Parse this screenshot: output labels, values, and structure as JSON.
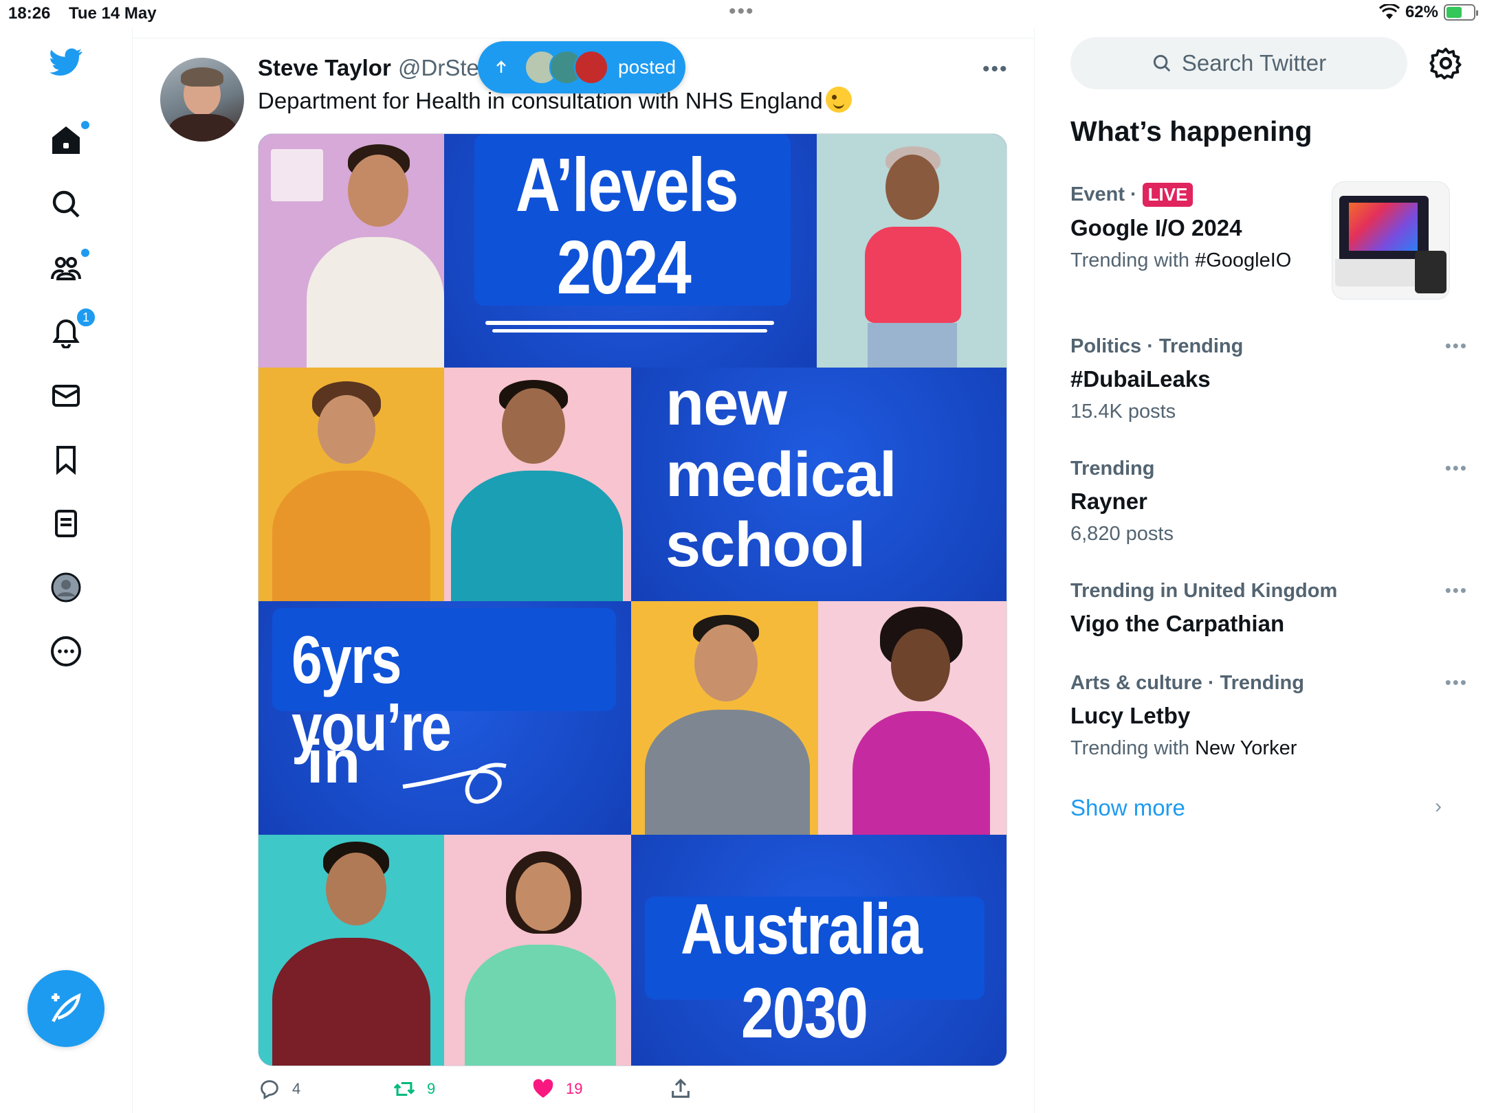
{
  "status_bar": {
    "time": "18:26",
    "date": "Tue 14 May",
    "battery": "62%",
    "battery_level": 0.62
  },
  "nav": {
    "notifications_badge": "1"
  },
  "tweet": {
    "author_name": "Steve Taylor",
    "author_handle": "@DrSte",
    "text": "Department for Health in consultation with NHS England",
    "posted_pill": "posted",
    "media": {
      "headline_1a": "A’levels",
      "headline_1b": "2024",
      "headline_2a": "new",
      "headline_2b": "medical",
      "headline_2c": "school",
      "headline_3a": "6yrs you’re",
      "headline_3b": "in",
      "headline_4a": "Australia",
      "headline_4b": "2030"
    },
    "replies": "4",
    "retweets": "9",
    "likes": "19"
  },
  "sidebar": {
    "search_placeholder": "Search Twitter",
    "whats_happening": "What’s happening",
    "trends": [
      {
        "meta": "Event",
        "badge": "LIVE",
        "title": "Google I/O 2024",
        "sub_prefix": "Trending with",
        "sub_value": "#GoogleIO"
      },
      {
        "meta": "Politics · Trending",
        "title": "#DubaiLeaks",
        "sub_prefix": "15.4K posts"
      },
      {
        "meta": "Trending",
        "title": "Rayner",
        "sub_prefix": "6,820 posts"
      },
      {
        "meta": "Trending in United Kingdom",
        "title": "Vigo the Carpathian"
      },
      {
        "meta": "Arts & culture · Trending",
        "title": "Lucy Letby",
        "sub_prefix": "Trending with",
        "sub_value": "New Yorker"
      }
    ],
    "show_more": "Show more"
  },
  "colors": {
    "accent": "#1d9bf0",
    "like": "#f91880",
    "retweet": "#00ba7c",
    "live": "#e0245e",
    "media_blue": "#1846c9"
  }
}
